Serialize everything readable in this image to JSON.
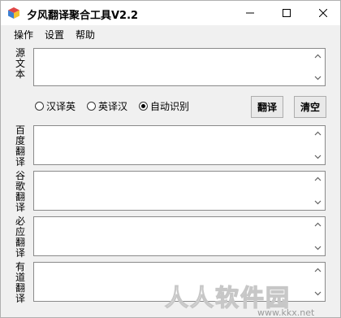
{
  "window": {
    "title": "夕风翻译聚合工具V2.2",
    "app_icon": "cube-icon"
  },
  "menu": [
    "操作",
    "设置",
    "帮助"
  ],
  "source": {
    "label": "源文本",
    "value": ""
  },
  "options": {
    "items": [
      {
        "label": "汉译英",
        "checked": false
      },
      {
        "label": "英译汉",
        "checked": false
      },
      {
        "label": "自动识别",
        "checked": true
      }
    ]
  },
  "buttons": {
    "translate": "翻译",
    "clear": "清空"
  },
  "results": [
    {
      "label": "百度翻译",
      "value": ""
    },
    {
      "label": "谷歌翻译",
      "value": ""
    },
    {
      "label": "必应翻译",
      "value": ""
    },
    {
      "label": "有道翻译",
      "value": ""
    }
  ],
  "watermark": {
    "text": "人人软件园",
    "url": "www.kkx.net"
  }
}
